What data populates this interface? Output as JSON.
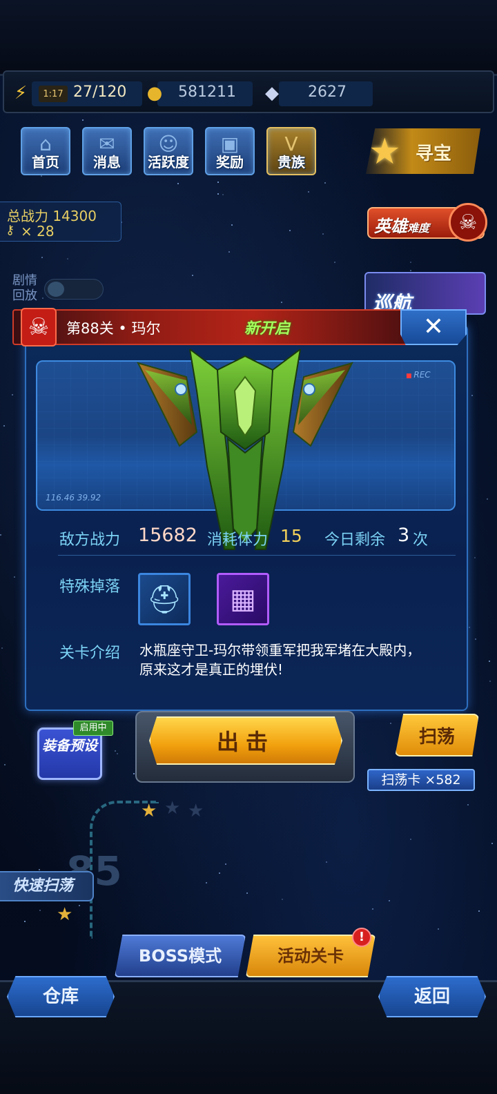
{
  "resources": {
    "stamina_timer": "1:17",
    "stamina": "27/120",
    "gold": "581211",
    "diamonds": "2627"
  },
  "nav": {
    "items": [
      {
        "label": "首页",
        "icon": "home-icon"
      },
      {
        "label": "消息",
        "icon": "mail-icon"
      },
      {
        "label": "活跃度",
        "icon": "smile-badge-icon"
      },
      {
        "label": "奖励",
        "icon": "gift-icon"
      },
      {
        "label": "贵族",
        "icon": "vip-icon"
      }
    ],
    "treasure_label": "寻宝"
  },
  "side": {
    "total_power_label": "总战力",
    "total_power_value": "14300",
    "keys": "× 28",
    "hero_difficulty": "英雄",
    "hero_difficulty_suffix": "难度",
    "replay_label_1": "剧情",
    "replay_label_2": "回放",
    "cruise_label": "巡航"
  },
  "dialog": {
    "title": "第88关 • 玛尔",
    "status": "新开启",
    "close": "✕",
    "rec": "REC",
    "coords": "116.46  39.92",
    "enemy_power_label": "敌方战力",
    "enemy_power_value": "15682",
    "stamina_cost_label": "消耗体力",
    "stamina_cost_value": "15",
    "remaining_label": "今日剩余",
    "remaining_value": "3",
    "remaining_unit": "次",
    "special_drop_label": "特殊掉落",
    "intro_label": "关卡介绍",
    "intro_text": "水瓶座守卫-玛尔带领重军把我军堵在大殿内，原来这才是真正的埋伏!"
  },
  "actions": {
    "equip_preset": "装备预设",
    "in_use": "启用中",
    "attack": "出击",
    "sweep": "扫荡",
    "sweep_card": "扫荡卡 ×582"
  },
  "map": {
    "node_number": "85",
    "quick_sweep": "快速扫荡",
    "boss_mode": "BOSS模式",
    "event_stage": "活动关卡",
    "event_badge": "!"
  },
  "bottom": {
    "warehouse": "仓库",
    "back": "返回"
  },
  "colors": {
    "accent_blue": "#2d6fc0",
    "header_red": "#b52418",
    "gold": "#f2a10e",
    "new_green": "#a4ff5c"
  }
}
